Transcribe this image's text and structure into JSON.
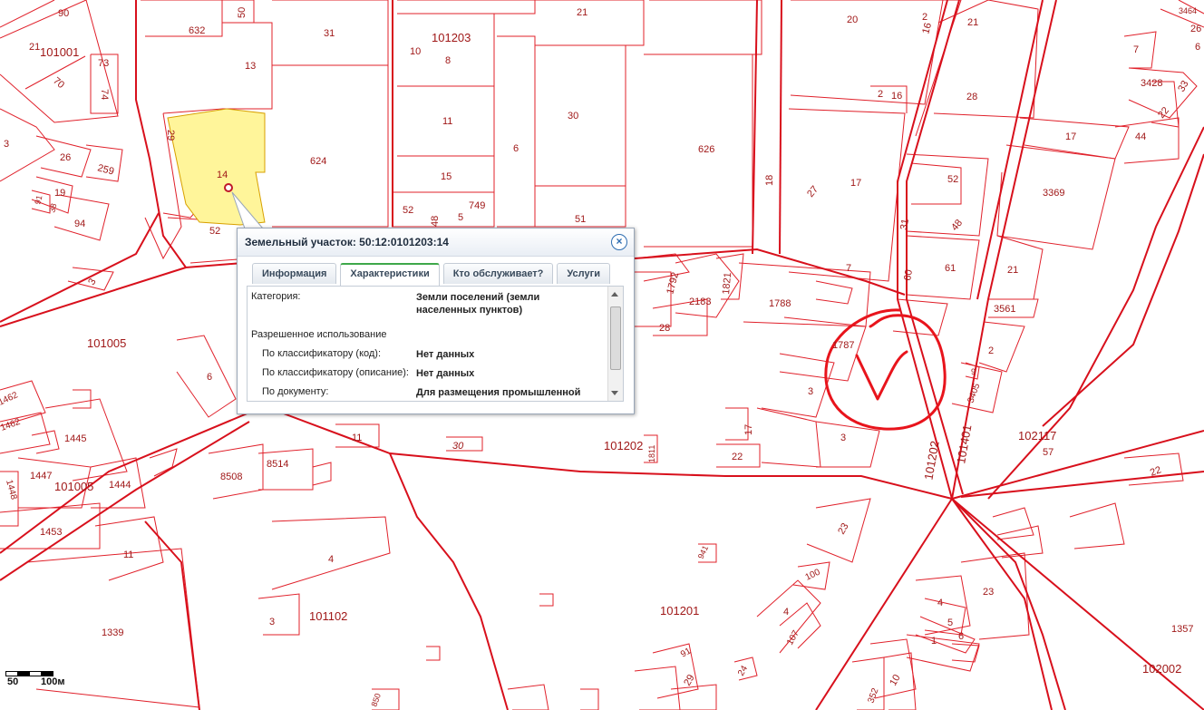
{
  "parcels": [
    {
      "label": "90"
    },
    {
      "label": "632"
    },
    {
      "label": "50"
    },
    {
      "label": "31"
    },
    {
      "label": "21"
    },
    {
      "label": "20"
    },
    {
      "label": "2"
    },
    {
      "label": "16"
    },
    {
      "label": "21"
    },
    {
      "label": "3464"
    },
    {
      "label": "26"
    },
    {
      "label": "21"
    },
    {
      "label": "101001"
    },
    {
      "label": "73"
    },
    {
      "label": "74"
    },
    {
      "label": "70"
    },
    {
      "label": "13"
    },
    {
      "label": "101203"
    },
    {
      "label": "10"
    },
    {
      "label": "8"
    },
    {
      "label": "7"
    },
    {
      "label": "6"
    },
    {
      "label": "3428"
    },
    {
      "label": "33"
    },
    {
      "label": "22"
    },
    {
      "label": "28"
    },
    {
      "label": "2"
    },
    {
      "label": "16"
    },
    {
      "label": "11"
    },
    {
      "label": "30"
    },
    {
      "label": "626"
    },
    {
      "label": "18"
    },
    {
      "label": "17"
    },
    {
      "label": "44"
    },
    {
      "label": "3"
    },
    {
      "label": "26"
    },
    {
      "label": "259"
    },
    {
      "label": "19"
    },
    {
      "label": "91"
    },
    {
      "label": "38"
    },
    {
      "label": "94"
    },
    {
      "label": "29"
    },
    {
      "label": "14"
    },
    {
      "label": "624"
    },
    {
      "label": "15"
    },
    {
      "label": "6"
    },
    {
      "label": "17"
    },
    {
      "label": "27"
    },
    {
      "label": "52"
    },
    {
      "label": "3369"
    },
    {
      "label": "52"
    },
    {
      "label": "48"
    },
    {
      "label": "5"
    },
    {
      "label": "749"
    },
    {
      "label": "51"
    },
    {
      "label": "31"
    },
    {
      "label": "48"
    },
    {
      "label": "52"
    },
    {
      "label": "7"
    },
    {
      "label": "61"
    },
    {
      "label": "60"
    },
    {
      "label": "21"
    },
    {
      "label": "3561"
    },
    {
      "label": "1792"
    },
    {
      "label": "2183"
    },
    {
      "label": "1821"
    },
    {
      "label": "1788"
    },
    {
      "label": "28"
    },
    {
      "label": "3"
    },
    {
      "label": "101005"
    },
    {
      "label": "6"
    },
    {
      "label": "2"
    },
    {
      "label": "1787"
    },
    {
      "label": "3"
    },
    {
      "label": "3405"
    },
    {
      "label": "9"
    },
    {
      "label": "1462"
    },
    {
      "label": "1462"
    },
    {
      "label": "1445"
    },
    {
      "label": "11"
    },
    {
      "label": "30"
    },
    {
      "label": "101202"
    },
    {
      "label": "1811"
    },
    {
      "label": "17"
    },
    {
      "label": "22"
    },
    {
      "label": "3"
    },
    {
      "label": "101202"
    },
    {
      "label": "101401"
    },
    {
      "label": "102117"
    },
    {
      "label": "57"
    },
    {
      "label": "1447"
    },
    {
      "label": "101005"
    },
    {
      "label": "1444"
    },
    {
      "label": "1448"
    },
    {
      "label": "8508"
    },
    {
      "label": "8514"
    },
    {
      "label": "22"
    },
    {
      "label": "1453"
    },
    {
      "label": "11"
    },
    {
      "label": "4"
    },
    {
      "label": "23"
    },
    {
      "label": "941"
    },
    {
      "label": "100"
    },
    {
      "label": "1339"
    },
    {
      "label": "3"
    },
    {
      "label": "101102"
    },
    {
      "label": "101201"
    },
    {
      "label": "4"
    },
    {
      "label": "23"
    },
    {
      "label": "4"
    },
    {
      "label": "5"
    },
    {
      "label": "107"
    },
    {
      "label": "1357"
    },
    {
      "label": "1"
    },
    {
      "label": "6"
    },
    {
      "label": "91"
    },
    {
      "label": "29"
    },
    {
      "label": "24"
    },
    {
      "label": "352"
    },
    {
      "label": "10"
    },
    {
      "label": "102002"
    },
    {
      "label": "850"
    }
  ],
  "popup": {
    "title": "Земельный участок: 50:12:0101203:14",
    "close_icon": "close-icon",
    "tabs": [
      "Информация",
      "Характеристики",
      "Кто обслуживает?",
      "Услуги"
    ],
    "active_tab": "Характеристики",
    "rows": {
      "category_label": "Категория:",
      "category_value": "Земли поселений (земли населенных пунктов)",
      "allowed_use_label": "Разрешенное использование",
      "classifier_code_label": "По классификатору (код):",
      "classifier_code_value": "Нет данных",
      "classifier_desc_label": "По классификатору (описание):",
      "classifier_desc_value": "Нет данных",
      "document_label": "По документу:",
      "document_value": "Для размещения промышленной"
    }
  },
  "scale": {
    "label_50": "50",
    "label_100": "100м"
  },
  "colors": {
    "parcel_line": "#e0202a",
    "road_line": "#d8101c",
    "highlight_fill": "#fff59a",
    "annotation": "#e8141c",
    "popup_border": "#9aa7b8",
    "active_tab_accent": "#3ea84a"
  }
}
